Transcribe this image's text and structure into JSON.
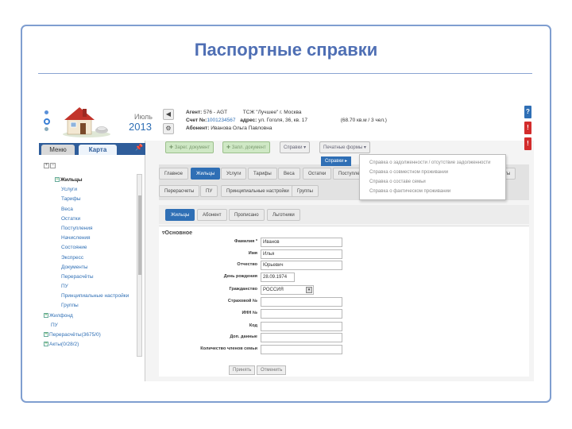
{
  "slide": {
    "title": "Паспортные справки"
  },
  "header": {
    "month": "Июль",
    "year": "2013",
    "agent_label": "Агент:",
    "agent_value": "576 - AGT",
    "org": "ТСЖ \"Лучшее\" г. Москва",
    "account_label": "Счет №:",
    "account_value": "1001234567",
    "address_label": "адрес:",
    "address_value": "ул. Гоголя, 36, кв. 17",
    "area": "(68.70 кв.м / 3 чел.)",
    "subscriber_label": "Абонент:",
    "subscriber_value": "Иванова Ольга Павловна",
    "side_icons": [
      "?",
      "!",
      "!"
    ]
  },
  "left_panel": {
    "tabs": [
      "Меню",
      "Карта"
    ],
    "tree": [
      {
        "label": "Жильцы",
        "kind": "section"
      },
      {
        "label": "Услуги",
        "kind": "sub"
      },
      {
        "label": "Тарифы",
        "kind": "sub"
      },
      {
        "label": "Веса",
        "kind": "sub"
      },
      {
        "label": "Остатки",
        "kind": "sub"
      },
      {
        "label": "Поступления",
        "kind": "sub"
      },
      {
        "label": "Начисления",
        "kind": "sub"
      },
      {
        "label": "Состояние",
        "kind": "sub"
      },
      {
        "label": "Экспресс",
        "kind": "sub"
      },
      {
        "label": "Документы",
        "kind": "sub"
      },
      {
        "label": "Перерасчёты",
        "kind": "sub"
      },
      {
        "label": "ПУ",
        "kind": "sub"
      },
      {
        "label": "Принципиальные настройки",
        "kind": "sub"
      },
      {
        "label": "Группы",
        "kind": "sub"
      },
      {
        "label": "Жилфонд",
        "kind": "top",
        "expandable": true
      },
      {
        "label": "ПУ",
        "kind": "top",
        "expandable": false
      },
      {
        "label": "Перерасчёты(3675/0)",
        "kind": "top",
        "expandable": true
      },
      {
        "label": "Акты(0/28/2)",
        "kind": "top",
        "expandable": true
      }
    ]
  },
  "toolbar": {
    "add_doc": "Зарег. документ",
    "sched_doc": "Запл. документ",
    "spravki": "Справки",
    "print_forms": "Печатные формы"
  },
  "dropdown": {
    "active": "Справки",
    "items": [
      "Справка о задолженности / отсутствие задолженности",
      "Справка о совместном проживании",
      "Справка о составе семьи",
      "Справка о фактическом проживании"
    ]
  },
  "tabs_row1": [
    "Главное",
    "Жильцы",
    "Услуги",
    "Тарифы",
    "Веса",
    "Остатки",
    "Поступле",
    "нты"
  ],
  "tabs_row2": [
    "Перерасчеты",
    "ПУ",
    "Принципиальные настройки",
    "Группы"
  ],
  "tabs_row3": [
    "Жильцы",
    "Абонент",
    "Прописано",
    "Льготники"
  ],
  "form": {
    "section": "Основное",
    "fields": [
      {
        "label": "Фамилия *",
        "value": "Иванов"
      },
      {
        "label": "Имя",
        "value": "Илья"
      },
      {
        "label": "Отчество",
        "value": "Юрьевич"
      },
      {
        "label": "День рождения",
        "value": "28.09.1974"
      },
      {
        "label": "Гражданство",
        "value": "РОССИЯ"
      },
      {
        "label": "Страховой №",
        "value": ""
      },
      {
        "label": "ИНН №",
        "value": ""
      },
      {
        "label": "Код",
        "value": ""
      },
      {
        "label": "Доп. данные",
        "value": ""
      },
      {
        "label": "Количество членов семьи",
        "value": ""
      }
    ],
    "accept": "Принять",
    "cancel": "Отменить"
  },
  "colors": {
    "accent": "#2f6fb5",
    "title": "#4f6fb4",
    "frame": "#7f9ed0",
    "tab_bar": "#2f5d9a"
  }
}
